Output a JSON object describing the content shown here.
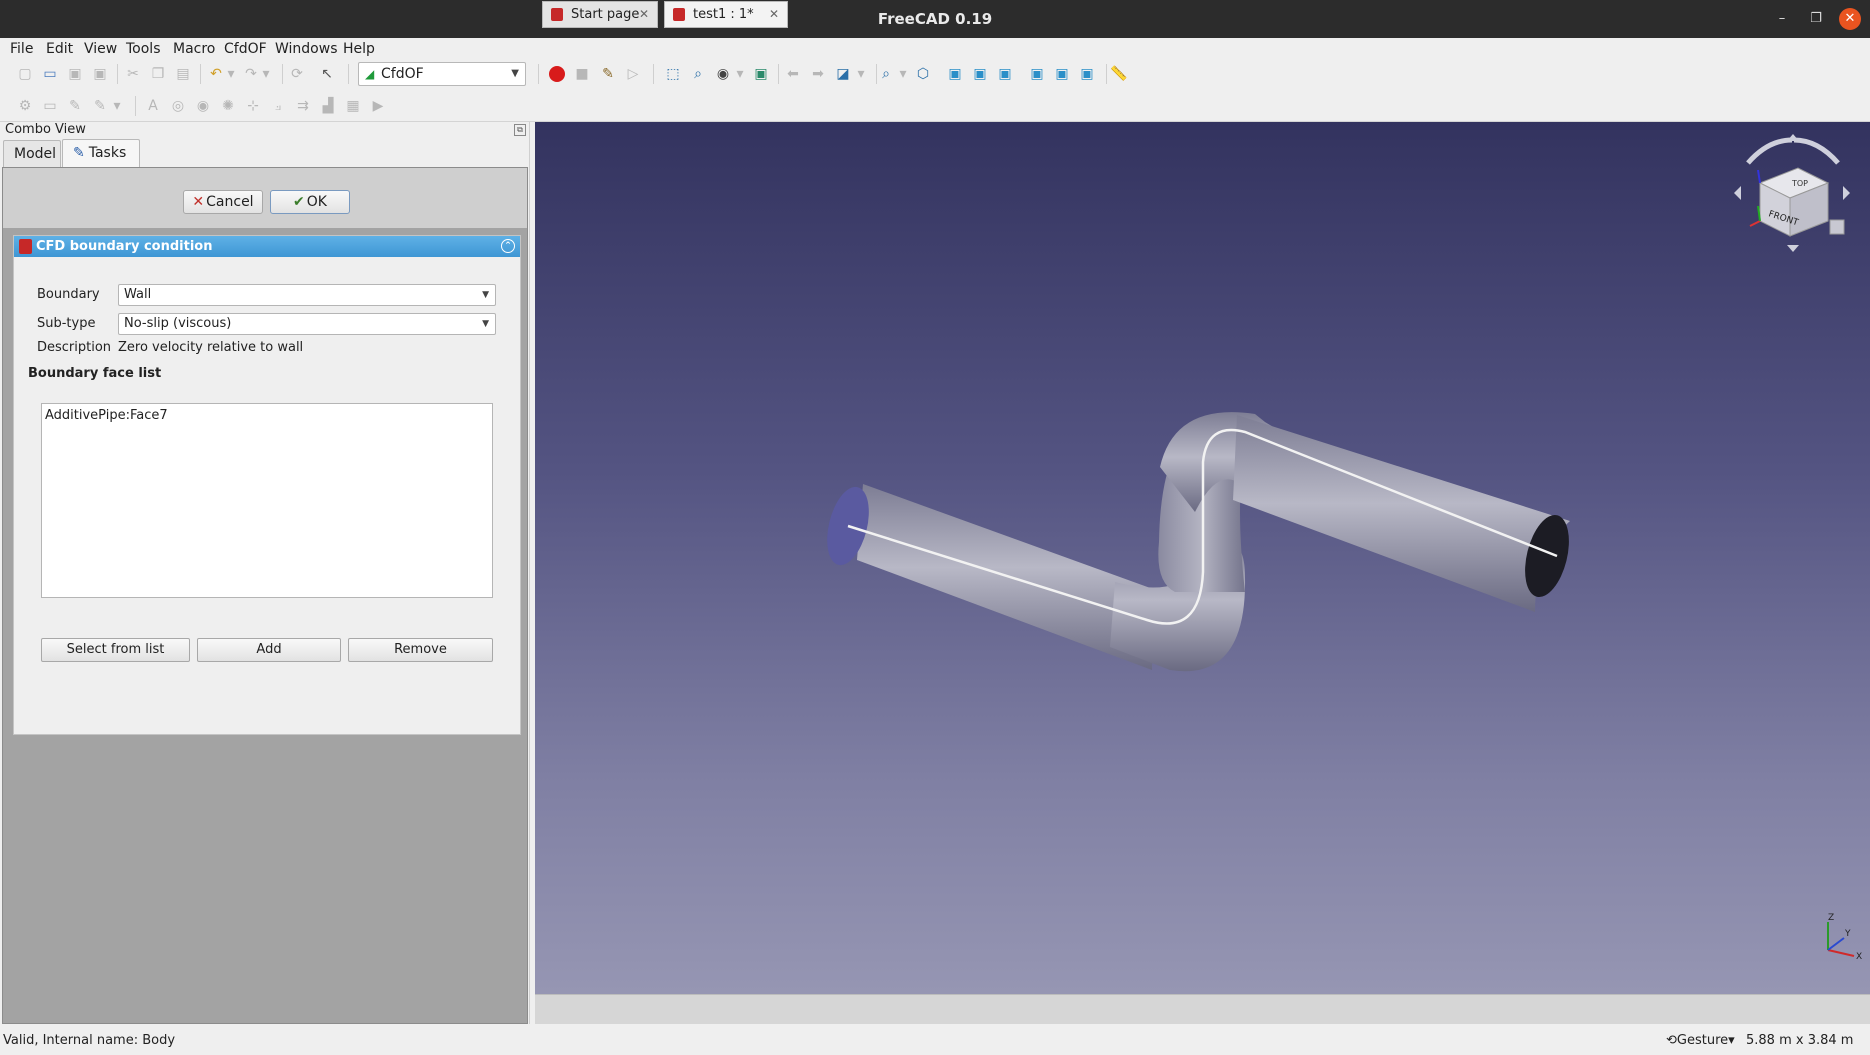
{
  "window": {
    "title": "FreeCAD 0.19"
  },
  "menu": [
    "File",
    "Edit",
    "View",
    "Tools",
    "Macro",
    "CfdOF",
    "Windows",
    "Help"
  ],
  "toolbar": {
    "workbench": "CfdOF"
  },
  "combo_view": {
    "title": "Combo View",
    "tabs": {
      "model": "Model",
      "tasks": "Tasks"
    }
  },
  "task": {
    "cancel_label": "Cancel",
    "ok_label": "OK",
    "panel_title": "CFD boundary condition",
    "boundary_label": "Boundary",
    "boundary_value": "Wall",
    "subtype_label": "Sub-type",
    "subtype_value": "No-slip (viscous)",
    "description_label": "Description",
    "description_value": "Zero velocity relative to wall",
    "face_list_title": "Boundary face list",
    "faces": [
      "AdditivePipe:Face7"
    ],
    "select_label": "Select from list",
    "add_label": "Add",
    "remove_label": "Remove"
  },
  "navcube": {
    "top": "TOP",
    "front": "FRONT"
  },
  "axes": {
    "x": "X",
    "y": "Y",
    "z": "Z"
  },
  "doc_tabs": {
    "start": "Start page",
    "test1": "test1 : 1*"
  },
  "status": {
    "text": "Valid, Internal name: Body",
    "nav_style": "Gesture",
    "dimensions": "5.88 m x 3.84 m"
  },
  "colors": {
    "header_blue": "#3e96d4",
    "close_orange": "#e95420",
    "record_red": "#d81b1b"
  }
}
